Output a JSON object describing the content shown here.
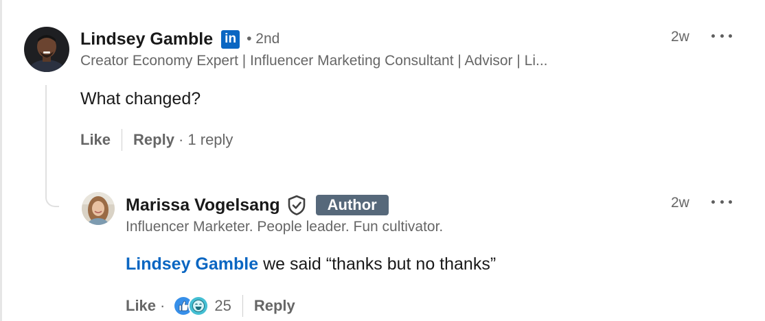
{
  "comment": {
    "author_name": "Lindsey Gamble",
    "linkedin_badge": "in",
    "degree": "• 2nd",
    "headline": "Creator Economy Expert | Influencer Marketing Consultant | Advisor | Li...",
    "timestamp": "2w",
    "text": "What changed?",
    "like_label": "Like",
    "reply_label": "Reply",
    "replies_count": "· 1 reply"
  },
  "reply": {
    "author_name": "Marissa Vogelsang",
    "author_badge": "Author",
    "headline": "Influencer Marketer. People leader. Fun cultivator.",
    "timestamp": "2w",
    "mention": "Lindsey Gamble",
    "text": " we said “thanks but no thanks”",
    "like_label": "Like",
    "sep": "·",
    "reaction_count": "25",
    "reply_label": "Reply"
  },
  "colors": {
    "link_blue": "#0a66c2",
    "muted_text": "#666666",
    "author_badge_bg": "#56687a"
  },
  "icons": [
    "linkedin-icon",
    "more-options-icon",
    "verified-shield-icon",
    "like-reaction-icon",
    "funny-reaction-icon"
  ]
}
